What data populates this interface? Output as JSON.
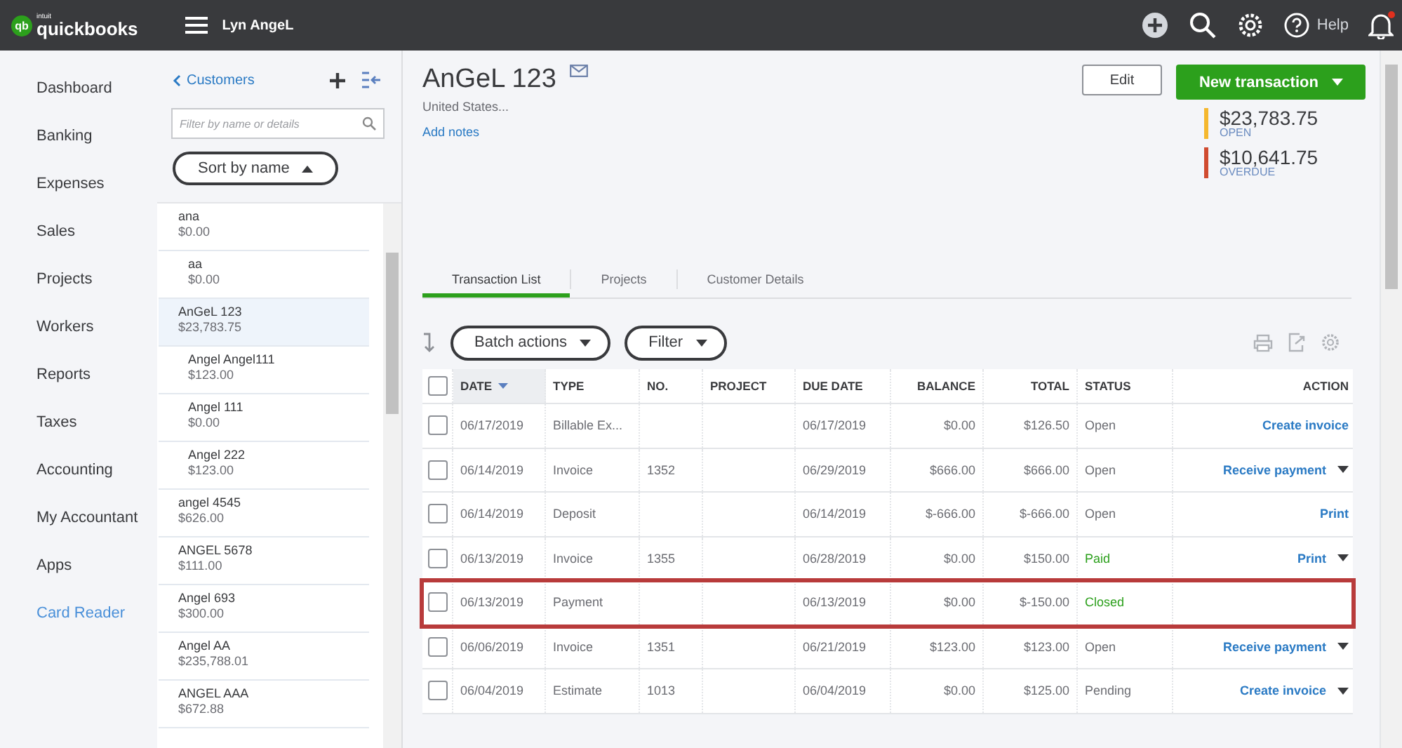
{
  "topbar": {
    "logo_mark": "qb",
    "logo_small": "intuit",
    "logo": "quickbooks",
    "company": "Lyn AngeL",
    "help": "Help",
    "notification": true
  },
  "nav": [
    {
      "label": "Dashboard",
      "kind": "item"
    },
    {
      "label": "Banking",
      "kind": "item"
    },
    {
      "label": "Expenses",
      "kind": "item"
    },
    {
      "label": "Sales",
      "kind": "item"
    },
    {
      "label": "Projects",
      "kind": "item"
    },
    {
      "label": "Workers",
      "kind": "item"
    },
    {
      "label": "Reports",
      "kind": "item"
    },
    {
      "label": "Taxes",
      "kind": "item"
    },
    {
      "label": "Accounting",
      "kind": "item"
    },
    {
      "label": "My Accountant",
      "kind": "item"
    },
    {
      "label": "Apps",
      "kind": "item"
    },
    {
      "label": "Card Reader",
      "kind": "link"
    }
  ],
  "customers": {
    "back": "Customers",
    "search": {
      "placeholder": "Filter by name or details"
    },
    "sort": "Sort by name",
    "items": [
      {
        "name": "ana",
        "amount": "$0.00",
        "selected": false,
        "children": [
          {
            "name": "aa",
            "amount": "$0.00",
            "selected": false
          }
        ]
      },
      {
        "name": "AnGeL 123",
        "amount": "$23,783.75",
        "selected": true,
        "children": [
          {
            "name": "Angel Angel111",
            "amount": "$123.00",
            "selected": false
          },
          {
            "name": "Angel 111",
            "amount": "$0.00",
            "selected": false
          },
          {
            "name": "Angel 222",
            "amount": "$123.00",
            "selected": false
          }
        ]
      },
      {
        "name": "angel 4545",
        "amount": "$626.00",
        "selected": false
      },
      {
        "name": "ANGEL 5678",
        "amount": "$111.00",
        "selected": false
      },
      {
        "name": "Angel 693",
        "amount": "$300.00",
        "selected": false
      },
      {
        "name": "Angel AA",
        "amount": "$235,788.01",
        "selected": false
      },
      {
        "name": "ANGEL AAA",
        "amount": "$672.88",
        "selected": false
      }
    ]
  },
  "customer": {
    "name": "AnGeL 123",
    "address": "United States...",
    "add_notes": "Add notes",
    "edit": "Edit",
    "new_transaction": "New transaction",
    "summary": [
      {
        "amount": "$23,783.75",
        "label": "OPEN",
        "color": "#f5b82e"
      },
      {
        "amount": "$10,641.75",
        "label": "OVERDUE",
        "color": "#d04b2f"
      }
    ]
  },
  "tabs": [
    {
      "label": "Transaction List",
      "selected": true
    },
    {
      "label": "Projects",
      "selected": false
    },
    {
      "label": "Customer Details",
      "selected": false
    }
  ],
  "toolbar": {
    "batch": "Batch actions",
    "filter": "Filter"
  },
  "table": {
    "select_all": {
      "checked": false
    },
    "columns": [
      {
        "label": "DATE",
        "sorted": true
      },
      {
        "label": "TYPE",
        "sorted": false
      },
      {
        "label": "NO.",
        "sorted": false
      },
      {
        "label": "PROJECT",
        "sorted": false
      },
      {
        "label": "DUE DATE",
        "sorted": false
      },
      {
        "label": "BALANCE",
        "sorted": false
      },
      {
        "label": "TOTAL",
        "sorted": false
      },
      {
        "label": "STATUS",
        "sorted": false
      },
      {
        "label": "ACTION",
        "sorted": false
      }
    ],
    "rows": [
      {
        "cells": [
          "06/17/2019",
          "Billable Ex...",
          "",
          "",
          "06/17/2019",
          "$0.00",
          "$126.50"
        ],
        "status": {
          "text": "Open",
          "color": "#6b6c72"
        },
        "action": {
          "text": "Create invoice",
          "menu": false
        },
        "highlighted": false,
        "checked": false
      },
      {
        "cells": [
          "06/14/2019",
          "Invoice",
          "1352",
          "",
          "06/29/2019",
          "$666.00",
          "$666.00"
        ],
        "status": {
          "text": "Open",
          "color": "#6b6c72"
        },
        "action": {
          "text": "Receive payment",
          "menu": true
        },
        "highlighted": false,
        "checked": false
      },
      {
        "cells": [
          "06/14/2019",
          "Deposit",
          "",
          "",
          "06/14/2019",
          "$-666.00",
          "$-666.00"
        ],
        "status": {
          "text": "Open",
          "color": "#6b6c72"
        },
        "action": {
          "text": "Print",
          "menu": false
        },
        "highlighted": false,
        "checked": false
      },
      {
        "cells": [
          "06/13/2019",
          "Invoice",
          "1355",
          "",
          "06/28/2019",
          "$0.00",
          "$150.00"
        ],
        "status": {
          "text": "Paid",
          "color": "#2ca01c"
        },
        "action": {
          "text": "Print",
          "menu": true
        },
        "highlighted": false,
        "checked": false
      },
      {
        "cells": [
          "06/13/2019",
          "Payment",
          "",
          "",
          "06/13/2019",
          "$0.00",
          "$-150.00"
        ],
        "status": {
          "text": "Closed",
          "color": "#2ca01c"
        },
        "highlighted": true,
        "checked": false
      },
      {
        "cells": [
          "06/06/2019",
          "Invoice",
          "1351",
          "",
          "06/21/2019",
          "$123.00",
          "$123.00"
        ],
        "status": {
          "text": "Open",
          "color": "#6b6c72"
        },
        "action": {
          "text": "Receive payment",
          "menu": true
        },
        "highlighted": false,
        "checked": false
      },
      {
        "cells": [
          "06/04/2019",
          "Estimate",
          "1013",
          "",
          "06/04/2019",
          "$0.00",
          "$125.00"
        ],
        "status": {
          "text": "Pending",
          "color": "#6b6c72"
        },
        "action": {
          "text": "Create invoice",
          "menu": true
        },
        "highlighted": false,
        "checked": false
      }
    ]
  }
}
